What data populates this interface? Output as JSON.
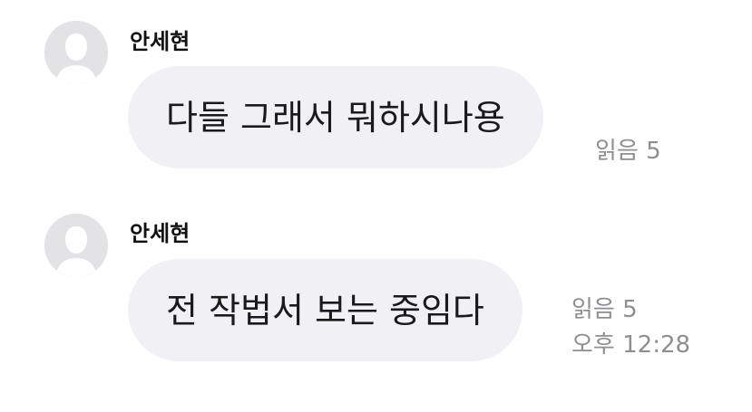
{
  "messages": [
    {
      "sender": "안세현",
      "text": "다들 그래서 뭐하시나용",
      "read_status": "읽음 5",
      "time": ""
    },
    {
      "sender": "안세현",
      "text": "전 작법서 보는 중임다",
      "read_status": "읽음 5",
      "time": "오후 12:28"
    }
  ],
  "icons": {
    "avatar": "default-profile-icon"
  },
  "colors": {
    "bubble_bg": "#f1f1f5",
    "meta_text": "#8e8e93",
    "avatar_bg": "#e3e3e6"
  }
}
